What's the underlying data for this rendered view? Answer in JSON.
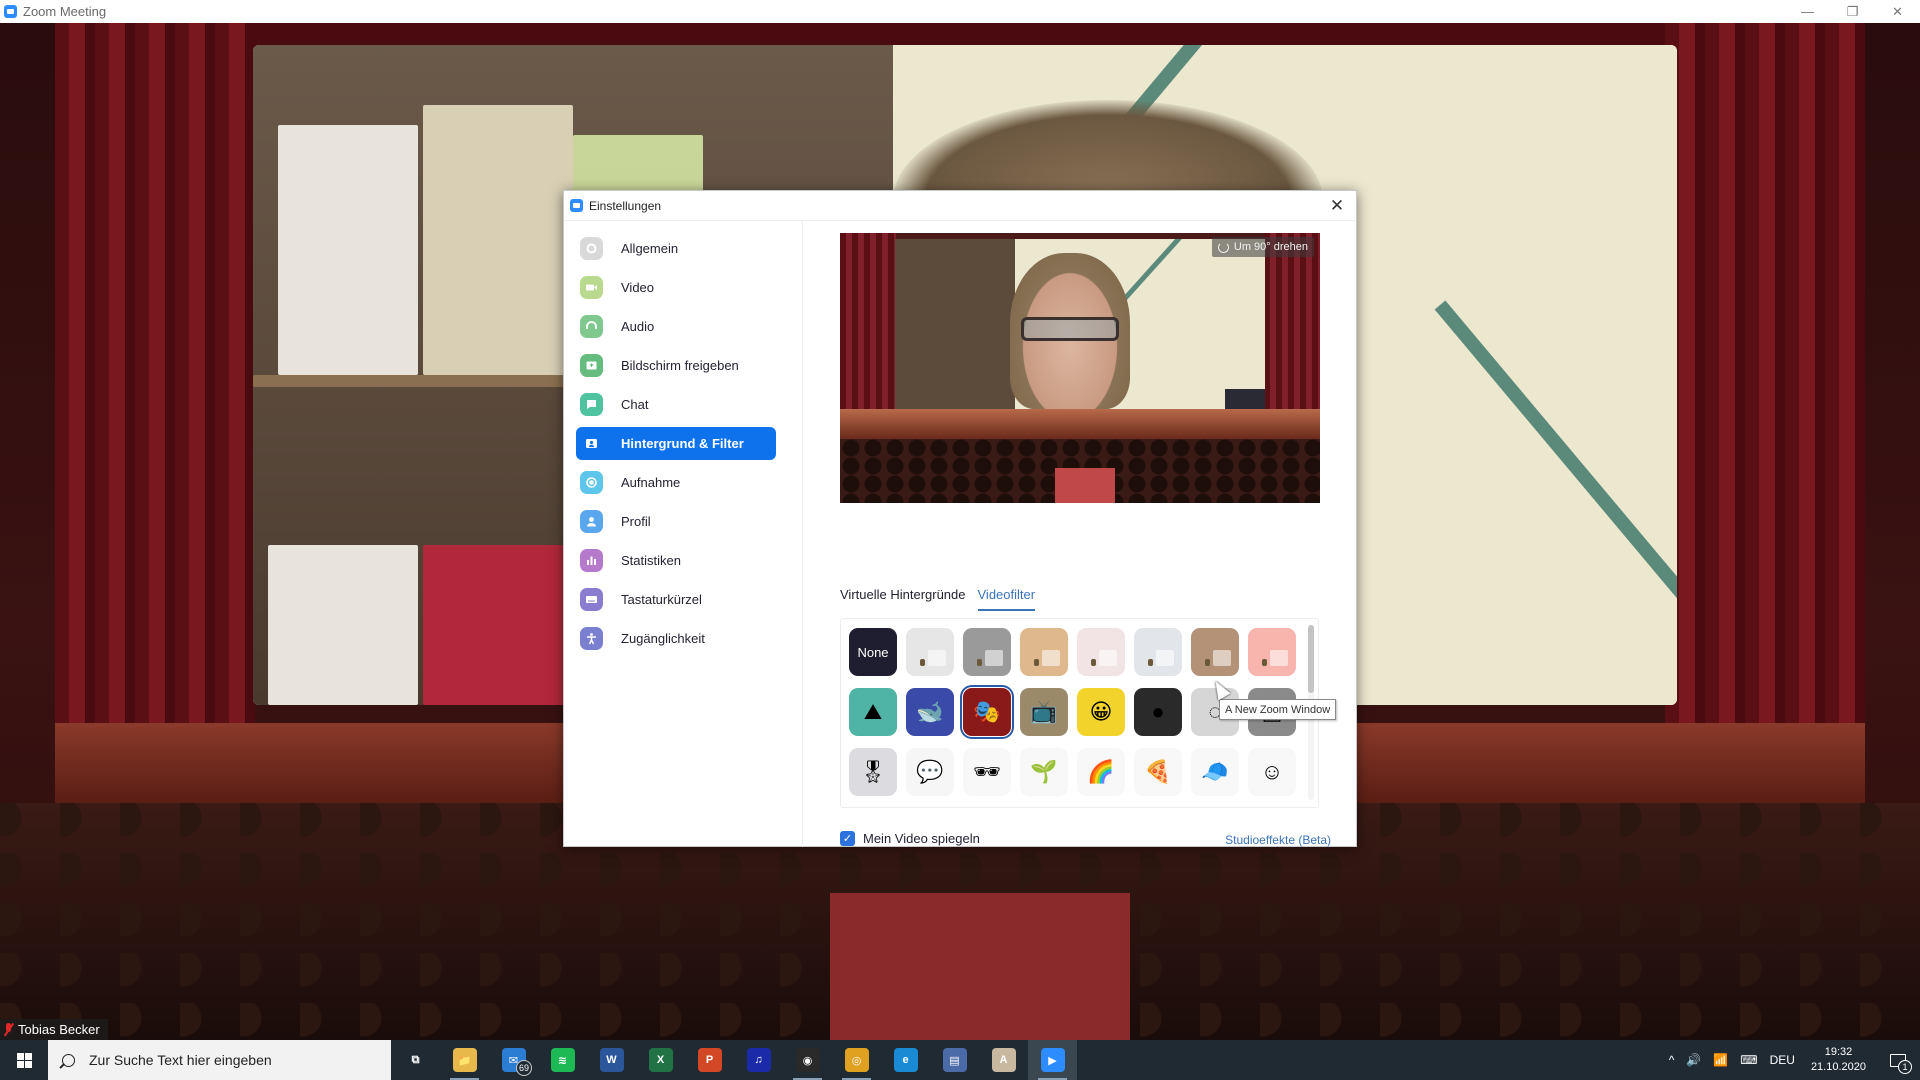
{
  "window": {
    "title": "Zoom Meeting",
    "controls": {
      "minimize": "—",
      "restore": "❐",
      "close": "✕"
    }
  },
  "meeting": {
    "participant_name": "Tobias Becker",
    "mic_muted": true
  },
  "settings_dialog": {
    "title": "Einstellungen",
    "close_label": "✕",
    "sidebar": {
      "active_index": 5,
      "items": [
        {
          "label": "Allgemein",
          "icon": "gear-icon",
          "color": "#d9d9d9"
        },
        {
          "label": "Video",
          "icon": "video-camera-icon",
          "color": "#b9d98f"
        },
        {
          "label": "Audio",
          "icon": "headphones-icon",
          "color": "#7fc98f"
        },
        {
          "label": "Bildschirm freigeben",
          "icon": "share-screen-icon",
          "color": "#66bb7f"
        },
        {
          "label": "Chat",
          "icon": "chat-bubble-icon",
          "color": "#4fc3a0"
        },
        {
          "label": "Hintergrund & Filter",
          "icon": "background-person-icon",
          "color": "#0e72ed"
        },
        {
          "label": "Aufnahme",
          "icon": "record-icon",
          "color": "#5ec6ea"
        },
        {
          "label": "Profil",
          "icon": "profile-icon",
          "color": "#5aa7ee"
        },
        {
          "label": "Statistiken",
          "icon": "bar-chart-icon",
          "color": "#b57acb"
        },
        {
          "label": "Tastaturkürzel",
          "icon": "keyboard-icon",
          "color": "#8a7dcf"
        },
        {
          "label": "Zugänglichkeit",
          "icon": "accessibility-icon",
          "color": "#7a7fd0"
        }
      ]
    },
    "preview": {
      "rotate_label": "Um 90° drehen"
    },
    "tabs": [
      {
        "label": "Virtuelle Hintergründe",
        "active": false
      },
      {
        "label": "Videofilter",
        "active": true
      }
    ],
    "filters": {
      "selected_index": 10,
      "hovered_index": 14,
      "scroll_fraction": 0.0,
      "items": [
        {
          "name": "None",
          "label": "None",
          "bg": "#1e1e30"
        },
        {
          "name": "filter-white",
          "bg": "#e6e6e6"
        },
        {
          "name": "filter-gray",
          "bg": "#9a9a9a"
        },
        {
          "name": "filter-tan",
          "bg": "#dfb88d"
        },
        {
          "name": "filter-blush",
          "bg": "#f2e4e4"
        },
        {
          "name": "filter-cool-white",
          "bg": "#e2e6ea"
        },
        {
          "name": "filter-brown",
          "bg": "#b39277"
        },
        {
          "name": "filter-pink",
          "bg": "#f7b5ad"
        },
        {
          "name": "frame-landscape",
          "bg": "#4fb3a6",
          "glyph": "⛰"
        },
        {
          "name": "frame-whale",
          "bg": "#3a4aa8",
          "glyph": "🐋"
        },
        {
          "name": "frame-theater",
          "bg": "#8a1a1a",
          "glyph": "🎭"
        },
        {
          "name": "frame-retro-tv",
          "bg": "#9a8a6a",
          "glyph": "📺"
        },
        {
          "name": "frame-emoji",
          "bg": "#f1d32c",
          "glyph": "😀"
        },
        {
          "name": "frame-bulbs",
          "bg": "#2a2a2a",
          "glyph": "●"
        },
        {
          "name": "frame-loading",
          "bg": "#d6d6d6",
          "glyph": "◌"
        },
        {
          "name": "frame-old-tv",
          "bg": "#8a8a8a",
          "glyph": "▣"
        },
        {
          "name": "sticker-medal",
          "bg": "#dcdce0",
          "glyph": "🎖"
        },
        {
          "name": "sticker-huh",
          "bg": "#f6f6f6",
          "glyph": "💬"
        },
        {
          "name": "sticker-sunglasses",
          "bg": "#f8f8f8",
          "glyph": "🕶"
        },
        {
          "name": "sticker-sprout",
          "bg": "#f8f8f8",
          "glyph": "🌱"
        },
        {
          "name": "sticker-rainbow",
          "bg": "#f8f8f8",
          "glyph": "🌈"
        },
        {
          "name": "sticker-pizza-hat",
          "bg": "#f8f8f8",
          "glyph": "🍕"
        },
        {
          "name": "sticker-cap",
          "bg": "#f8f8f8",
          "glyph": "🧢"
        },
        {
          "name": "sticker-face",
          "bg": "#f8f8f8",
          "glyph": "☺"
        }
      ]
    },
    "tooltip": "A New Zoom Window",
    "mirror_video": {
      "label": "Mein Video spiegeln",
      "checked": true
    },
    "studio_effects_link": "Studioeffekte (Beta)"
  },
  "taskbar": {
    "search_placeholder": "Zur Suche Text hier eingeben",
    "apps": [
      {
        "name": "task-view",
        "glyph": "⧉",
        "color": "transparent",
        "running": false
      },
      {
        "name": "file-explorer",
        "glyph": "📁",
        "color": "#e8b84a",
        "running": true
      },
      {
        "name": "mail",
        "glyph": "✉",
        "color": "#2b7cd3",
        "running": false,
        "badge": "69"
      },
      {
        "name": "spotify",
        "glyph": "≋",
        "color": "#1db954",
        "running": false
      },
      {
        "name": "word",
        "glyph": "W",
        "color": "#2b579a",
        "running": false
      },
      {
        "name": "excel",
        "glyph": "X",
        "color": "#217346",
        "running": false
      },
      {
        "name": "powerpoint",
        "glyph": "P",
        "color": "#d24726",
        "running": false
      },
      {
        "name": "audacity",
        "glyph": "♫",
        "color": "#1a2aa8",
        "running": false
      },
      {
        "name": "obs",
        "glyph": "◉",
        "color": "#2a2a2a",
        "running": true
      },
      {
        "name": "chrome",
        "glyph": "◎",
        "color": "#e0a020",
        "running": true
      },
      {
        "name": "edge",
        "glyph": "e",
        "color": "#1a8ad4",
        "running": false
      },
      {
        "name": "photo-app",
        "glyph": "▤",
        "color": "#4a6aa8",
        "running": false
      },
      {
        "name": "document-app",
        "glyph": "A",
        "color": "#c8b8a0",
        "running": false
      },
      {
        "name": "zoom",
        "glyph": "▶",
        "color": "#2d8cff",
        "running": true,
        "active": true
      }
    ],
    "tray": {
      "chevron": "^",
      "volume": "🔊",
      "network": "📶",
      "keyboard": "⌨",
      "language": "DEU",
      "time": "19:32",
      "date": "21.10.2020",
      "notifications": "1"
    }
  }
}
